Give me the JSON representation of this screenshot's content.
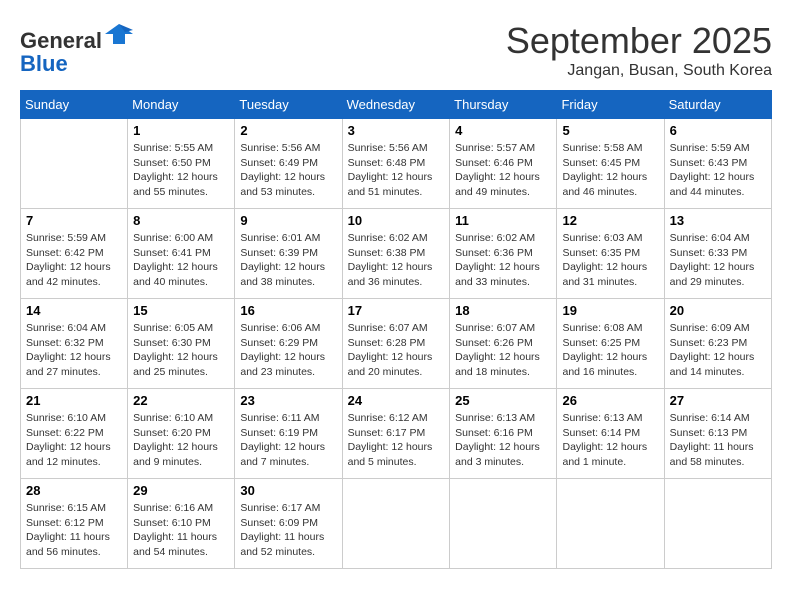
{
  "header": {
    "logo_line1": "General",
    "logo_line2": "Blue",
    "month": "September 2025",
    "location": "Jangan, Busan, South Korea"
  },
  "weekdays": [
    "Sunday",
    "Monday",
    "Tuesday",
    "Wednesday",
    "Thursday",
    "Friday",
    "Saturday"
  ],
  "weeks": [
    [
      {
        "day": "",
        "sunrise": "",
        "sunset": "",
        "daylight": ""
      },
      {
        "day": "1",
        "sunrise": "Sunrise: 5:55 AM",
        "sunset": "Sunset: 6:50 PM",
        "daylight": "Daylight: 12 hours and 55 minutes."
      },
      {
        "day": "2",
        "sunrise": "Sunrise: 5:56 AM",
        "sunset": "Sunset: 6:49 PM",
        "daylight": "Daylight: 12 hours and 53 minutes."
      },
      {
        "day": "3",
        "sunrise": "Sunrise: 5:56 AM",
        "sunset": "Sunset: 6:48 PM",
        "daylight": "Daylight: 12 hours and 51 minutes."
      },
      {
        "day": "4",
        "sunrise": "Sunrise: 5:57 AM",
        "sunset": "Sunset: 6:46 PM",
        "daylight": "Daylight: 12 hours and 49 minutes."
      },
      {
        "day": "5",
        "sunrise": "Sunrise: 5:58 AM",
        "sunset": "Sunset: 6:45 PM",
        "daylight": "Daylight: 12 hours and 46 minutes."
      },
      {
        "day": "6",
        "sunrise": "Sunrise: 5:59 AM",
        "sunset": "Sunset: 6:43 PM",
        "daylight": "Daylight: 12 hours and 44 minutes."
      }
    ],
    [
      {
        "day": "7",
        "sunrise": "Sunrise: 5:59 AM",
        "sunset": "Sunset: 6:42 PM",
        "daylight": "Daylight: 12 hours and 42 minutes."
      },
      {
        "day": "8",
        "sunrise": "Sunrise: 6:00 AM",
        "sunset": "Sunset: 6:41 PM",
        "daylight": "Daylight: 12 hours and 40 minutes."
      },
      {
        "day": "9",
        "sunrise": "Sunrise: 6:01 AM",
        "sunset": "Sunset: 6:39 PM",
        "daylight": "Daylight: 12 hours and 38 minutes."
      },
      {
        "day": "10",
        "sunrise": "Sunrise: 6:02 AM",
        "sunset": "Sunset: 6:38 PM",
        "daylight": "Daylight: 12 hours and 36 minutes."
      },
      {
        "day": "11",
        "sunrise": "Sunrise: 6:02 AM",
        "sunset": "Sunset: 6:36 PM",
        "daylight": "Daylight: 12 hours and 33 minutes."
      },
      {
        "day": "12",
        "sunrise": "Sunrise: 6:03 AM",
        "sunset": "Sunset: 6:35 PM",
        "daylight": "Daylight: 12 hours and 31 minutes."
      },
      {
        "day": "13",
        "sunrise": "Sunrise: 6:04 AM",
        "sunset": "Sunset: 6:33 PM",
        "daylight": "Daylight: 12 hours and 29 minutes."
      }
    ],
    [
      {
        "day": "14",
        "sunrise": "Sunrise: 6:04 AM",
        "sunset": "Sunset: 6:32 PM",
        "daylight": "Daylight: 12 hours and 27 minutes."
      },
      {
        "day": "15",
        "sunrise": "Sunrise: 6:05 AM",
        "sunset": "Sunset: 6:30 PM",
        "daylight": "Daylight: 12 hours and 25 minutes."
      },
      {
        "day": "16",
        "sunrise": "Sunrise: 6:06 AM",
        "sunset": "Sunset: 6:29 PM",
        "daylight": "Daylight: 12 hours and 23 minutes."
      },
      {
        "day": "17",
        "sunrise": "Sunrise: 6:07 AM",
        "sunset": "Sunset: 6:28 PM",
        "daylight": "Daylight: 12 hours and 20 minutes."
      },
      {
        "day": "18",
        "sunrise": "Sunrise: 6:07 AM",
        "sunset": "Sunset: 6:26 PM",
        "daylight": "Daylight: 12 hours and 18 minutes."
      },
      {
        "day": "19",
        "sunrise": "Sunrise: 6:08 AM",
        "sunset": "Sunset: 6:25 PM",
        "daylight": "Daylight: 12 hours and 16 minutes."
      },
      {
        "day": "20",
        "sunrise": "Sunrise: 6:09 AM",
        "sunset": "Sunset: 6:23 PM",
        "daylight": "Daylight: 12 hours and 14 minutes."
      }
    ],
    [
      {
        "day": "21",
        "sunrise": "Sunrise: 6:10 AM",
        "sunset": "Sunset: 6:22 PM",
        "daylight": "Daylight: 12 hours and 12 minutes."
      },
      {
        "day": "22",
        "sunrise": "Sunrise: 6:10 AM",
        "sunset": "Sunset: 6:20 PM",
        "daylight": "Daylight: 12 hours and 9 minutes."
      },
      {
        "day": "23",
        "sunrise": "Sunrise: 6:11 AM",
        "sunset": "Sunset: 6:19 PM",
        "daylight": "Daylight: 12 hours and 7 minutes."
      },
      {
        "day": "24",
        "sunrise": "Sunrise: 6:12 AM",
        "sunset": "Sunset: 6:17 PM",
        "daylight": "Daylight: 12 hours and 5 minutes."
      },
      {
        "day": "25",
        "sunrise": "Sunrise: 6:13 AM",
        "sunset": "Sunset: 6:16 PM",
        "daylight": "Daylight: 12 hours and 3 minutes."
      },
      {
        "day": "26",
        "sunrise": "Sunrise: 6:13 AM",
        "sunset": "Sunset: 6:14 PM",
        "daylight": "Daylight: 12 hours and 1 minute."
      },
      {
        "day": "27",
        "sunrise": "Sunrise: 6:14 AM",
        "sunset": "Sunset: 6:13 PM",
        "daylight": "Daylight: 11 hours and 58 minutes."
      }
    ],
    [
      {
        "day": "28",
        "sunrise": "Sunrise: 6:15 AM",
        "sunset": "Sunset: 6:12 PM",
        "daylight": "Daylight: 11 hours and 56 minutes."
      },
      {
        "day": "29",
        "sunrise": "Sunrise: 6:16 AM",
        "sunset": "Sunset: 6:10 PM",
        "daylight": "Daylight: 11 hours and 54 minutes."
      },
      {
        "day": "30",
        "sunrise": "Sunrise: 6:17 AM",
        "sunset": "Sunset: 6:09 PM",
        "daylight": "Daylight: 11 hours and 52 minutes."
      },
      {
        "day": "",
        "sunrise": "",
        "sunset": "",
        "daylight": ""
      },
      {
        "day": "",
        "sunrise": "",
        "sunset": "",
        "daylight": ""
      },
      {
        "day": "",
        "sunrise": "",
        "sunset": "",
        "daylight": ""
      },
      {
        "day": "",
        "sunrise": "",
        "sunset": "",
        "daylight": ""
      }
    ]
  ]
}
